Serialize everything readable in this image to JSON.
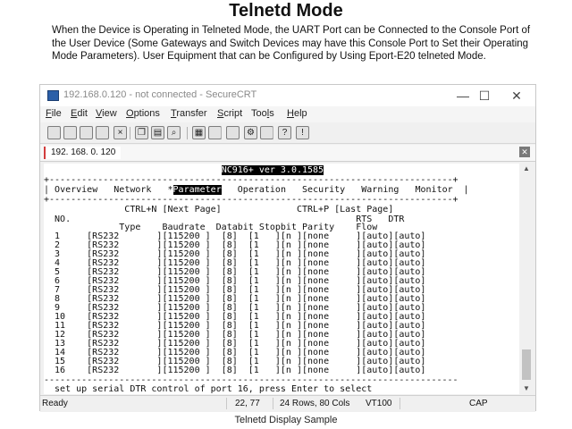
{
  "heading": "Telnetd Mode",
  "description": "When the Device is Operating in Telneted Mode, the UART Port can be Connected to the Console Port of the User Device (Some Gateways and Switch Devices may have this Console Port to Set their Operating Mode Parameters). User Equipment that can be Configured by Using Eport-E20 telneted Mode.",
  "window": {
    "title": "192.168.0.120 - not connected - SecureCRT",
    "minimize": "—",
    "maximize": "☐",
    "close": "✕"
  },
  "menu": [
    "File",
    "Edit",
    "View",
    "Options",
    "Transfer",
    "Script",
    "Tools",
    "Help"
  ],
  "menu_mnemonic": [
    "F",
    "E",
    "V",
    "O",
    "T",
    "S",
    "l",
    "H"
  ],
  "toolbar_icons": [
    "reconnect-icon",
    "connect-icon",
    "quick-connect-icon",
    "connect-tab-icon",
    "disconnect-icon",
    "copy-icon",
    "paste-icon",
    "find-icon",
    "print-icon",
    "print-setup-icon",
    "session-options-icon",
    "keymap-icon",
    "sftp-icon",
    "help-icon",
    "about-icon"
  ],
  "tab": {
    "label": "192. 168. 0. 120",
    "close": "✕"
  },
  "terminal": {
    "banner": "NC916+ ver 3.0.1585",
    "nav_items": [
      "Overview",
      "Network",
      "Parameter",
      "Operation",
      "Security",
      "Warning",
      "Monitor"
    ],
    "nav_selected": "Parameter",
    "nav_marker": "*",
    "paging_next": "CTRL+N [Next Page]",
    "paging_prev": "CTRL+P [Last Page]",
    "columns": [
      "NO.",
      "Type",
      "Baudrate",
      "Databit",
      "Stopbit",
      "Parity",
      "Flow",
      "RTS",
      "DTR"
    ],
    "rows": [
      [
        "1",
        "RS232",
        "115200",
        "8",
        "1",
        "n",
        "none",
        "auto",
        "auto"
      ],
      [
        "2",
        "RS232",
        "115200",
        "8",
        "1",
        "n",
        "none",
        "auto",
        "auto"
      ],
      [
        "3",
        "RS232",
        "115200",
        "8",
        "1",
        "n",
        "none",
        "auto",
        "auto"
      ],
      [
        "4",
        "RS232",
        "115200",
        "8",
        "1",
        "n",
        "none",
        "auto",
        "auto"
      ],
      [
        "5",
        "RS232",
        "115200",
        "8",
        "1",
        "n",
        "none",
        "auto",
        "auto"
      ],
      [
        "6",
        "RS232",
        "115200",
        "8",
        "1",
        "n",
        "none",
        "auto",
        "auto"
      ],
      [
        "7",
        "RS232",
        "115200",
        "8",
        "1",
        "n",
        "none",
        "auto",
        "auto"
      ],
      [
        "8",
        "RS232",
        "115200",
        "8",
        "1",
        "n",
        "none",
        "auto",
        "auto"
      ],
      [
        "9",
        "RS232",
        "115200",
        "8",
        "1",
        "n",
        "none",
        "auto",
        "auto"
      ],
      [
        "10",
        "RS232",
        "115200",
        "8",
        "1",
        "n",
        "none",
        "auto",
        "auto"
      ],
      [
        "11",
        "RS232",
        "115200",
        "8",
        "1",
        "n",
        "none",
        "auto",
        "auto"
      ],
      [
        "12",
        "RS232",
        "115200",
        "8",
        "1",
        "n",
        "none",
        "auto",
        "auto"
      ],
      [
        "13",
        "RS232",
        "115200",
        "8",
        "1",
        "n",
        "none",
        "auto",
        "auto"
      ],
      [
        "14",
        "RS232",
        "115200",
        "8",
        "1",
        "n",
        "none",
        "auto",
        "auto"
      ],
      [
        "15",
        "RS232",
        "115200",
        "8",
        "1",
        "n",
        "none",
        "auto",
        "auto"
      ],
      [
        "16",
        "RS232",
        "115200",
        "8",
        "1",
        "n",
        "none",
        "auto",
        "auto"
      ]
    ],
    "help_text": "set up serial DTR control of port 16, press Enter to select"
  },
  "status": {
    "ready": "Ready",
    "position": "22, 77",
    "size": "24 Rows, 80 Cols",
    "emulation": "VT100",
    "caps": "CAP"
  },
  "caption": "Telnetd Display Sample"
}
